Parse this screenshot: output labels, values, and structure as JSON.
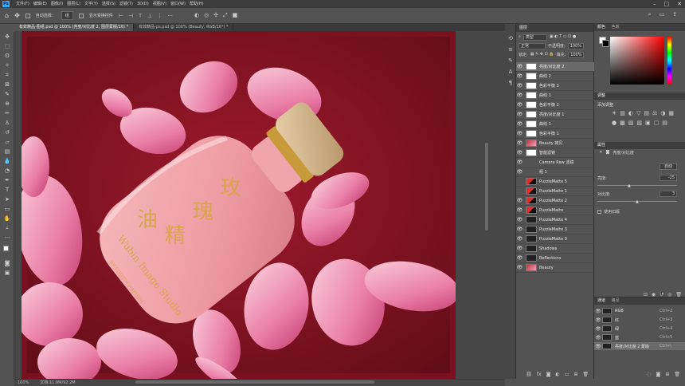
{
  "menubar": {
    "logo": "Ps",
    "items": [
      "文件(F)",
      "编辑(E)",
      "图像(I)",
      "图层(L)",
      "文字(Y)",
      "选择(S)",
      "滤镜(T)",
      "3D(D)",
      "视图(V)",
      "窗口(W)",
      "帮助(H)"
    ]
  },
  "window_controls": [
    "–",
    "□",
    "✕"
  ],
  "options": {
    "auto_select_label": "自动选择：",
    "auto_select_value": "组",
    "show_transform_label": "显示变换控件"
  },
  "tabs": [
    "有效精品-图组.psd @ 100% (亮度/对比度 2, 图层蒙版/16) *",
    "有效精品-ps.psd @ 100% (Beauty, RGB/16*) *"
  ],
  "status": {
    "zoom": "100%",
    "doc": "文档:11.9M/92.2M"
  },
  "layers_panel": {
    "title": "图层",
    "filter_label": "类型",
    "blend_mode": "正常",
    "opacity_label": "不透明度:",
    "opacity_value": "100%",
    "lock_label": "锁定:",
    "fill_label": "填充:",
    "fill_value": "100%",
    "layers": [
      {
        "name": "亮度/对比度 2",
        "thumb": "adj",
        "selected": true,
        "visible": true
      },
      {
        "name": "曲线 2",
        "thumb": "adj",
        "visible": true
      },
      {
        "name": "色彩平衡 3",
        "thumb": "adj",
        "visible": true
      },
      {
        "name": "曲线 1",
        "thumb": "adj",
        "visible": true
      },
      {
        "name": "色彩平衡 2",
        "thumb": "adj",
        "visible": true
      },
      {
        "name": "亮度/对比度 1",
        "thumb": "adj",
        "visible": true
      },
      {
        "name": "曲线 1",
        "thumb": "adj",
        "visible": true
      },
      {
        "name": "色彩平衡 1",
        "thumb": "adj",
        "visible": true
      },
      {
        "name": "Beauty 拷贝",
        "thumb": "beauty",
        "visible": true
      },
      {
        "name": "智能滤镜",
        "thumb": "adj",
        "visible": true
      },
      {
        "name": "Camera Raw 滤镜",
        "thumb": "none",
        "visible": true
      },
      {
        "name": "组 1",
        "thumb": "none",
        "visible": true
      },
      {
        "name": "PuzzleMatte 5",
        "thumb": "red",
        "visible": false
      },
      {
        "name": "PuzzleMatte 1",
        "thumb": "red",
        "visible": false
      },
      {
        "name": "PuzzleMatte 2",
        "thumb": "red",
        "visible": true
      },
      {
        "name": "PuzzleMatte",
        "thumb": "red",
        "visible": true
      },
      {
        "name": "PuzzleMatte 4",
        "thumb": "dark",
        "visible": true
      },
      {
        "name": "PuzzleMatte 3",
        "thumb": "dark",
        "visible": true
      },
      {
        "name": "PuzzleMatte 0",
        "thumb": "dark",
        "visible": true
      },
      {
        "name": "Shadows",
        "thumb": "dark",
        "visible": true
      },
      {
        "name": "Reflections",
        "thumb": "dark",
        "visible": true
      },
      {
        "name": "Beauty",
        "thumb": "beauty",
        "visible": true
      }
    ]
  },
  "color_panel": {
    "tabs": [
      "颜色",
      "色板"
    ]
  },
  "adjust_panel": {
    "title": "调整",
    "subtitle": "添加调整"
  },
  "props_panel": {
    "title": "属性",
    "layer_type": "亮度/对比度",
    "auto_label": "自动",
    "brightness_label": "亮度:",
    "brightness_value": "-25",
    "contrast_label": "对比度:",
    "contrast_value": "3",
    "legacy_label": "使用旧版"
  },
  "channels_panel": {
    "tabs": [
      "通道",
      "路径"
    ],
    "channels": [
      {
        "name": "RGB",
        "shortcut": "Ctrl+2"
      },
      {
        "name": "红",
        "shortcut": "Ctrl+3"
      },
      {
        "name": "绿",
        "shortcut": "Ctrl+4"
      },
      {
        "name": "蓝",
        "shortcut": "Ctrl+5"
      },
      {
        "name": "亮度/对比度 2 蒙版",
        "shortcut": "Ctrl+\\",
        "selected": true
      }
    ]
  },
  "bottle": {
    "title_chars": [
      "玫",
      "瑰",
      "精",
      "油"
    ],
    "brand": "Wubin Image Studio",
    "tagline": "BY PHOTOGRAPHER"
  }
}
